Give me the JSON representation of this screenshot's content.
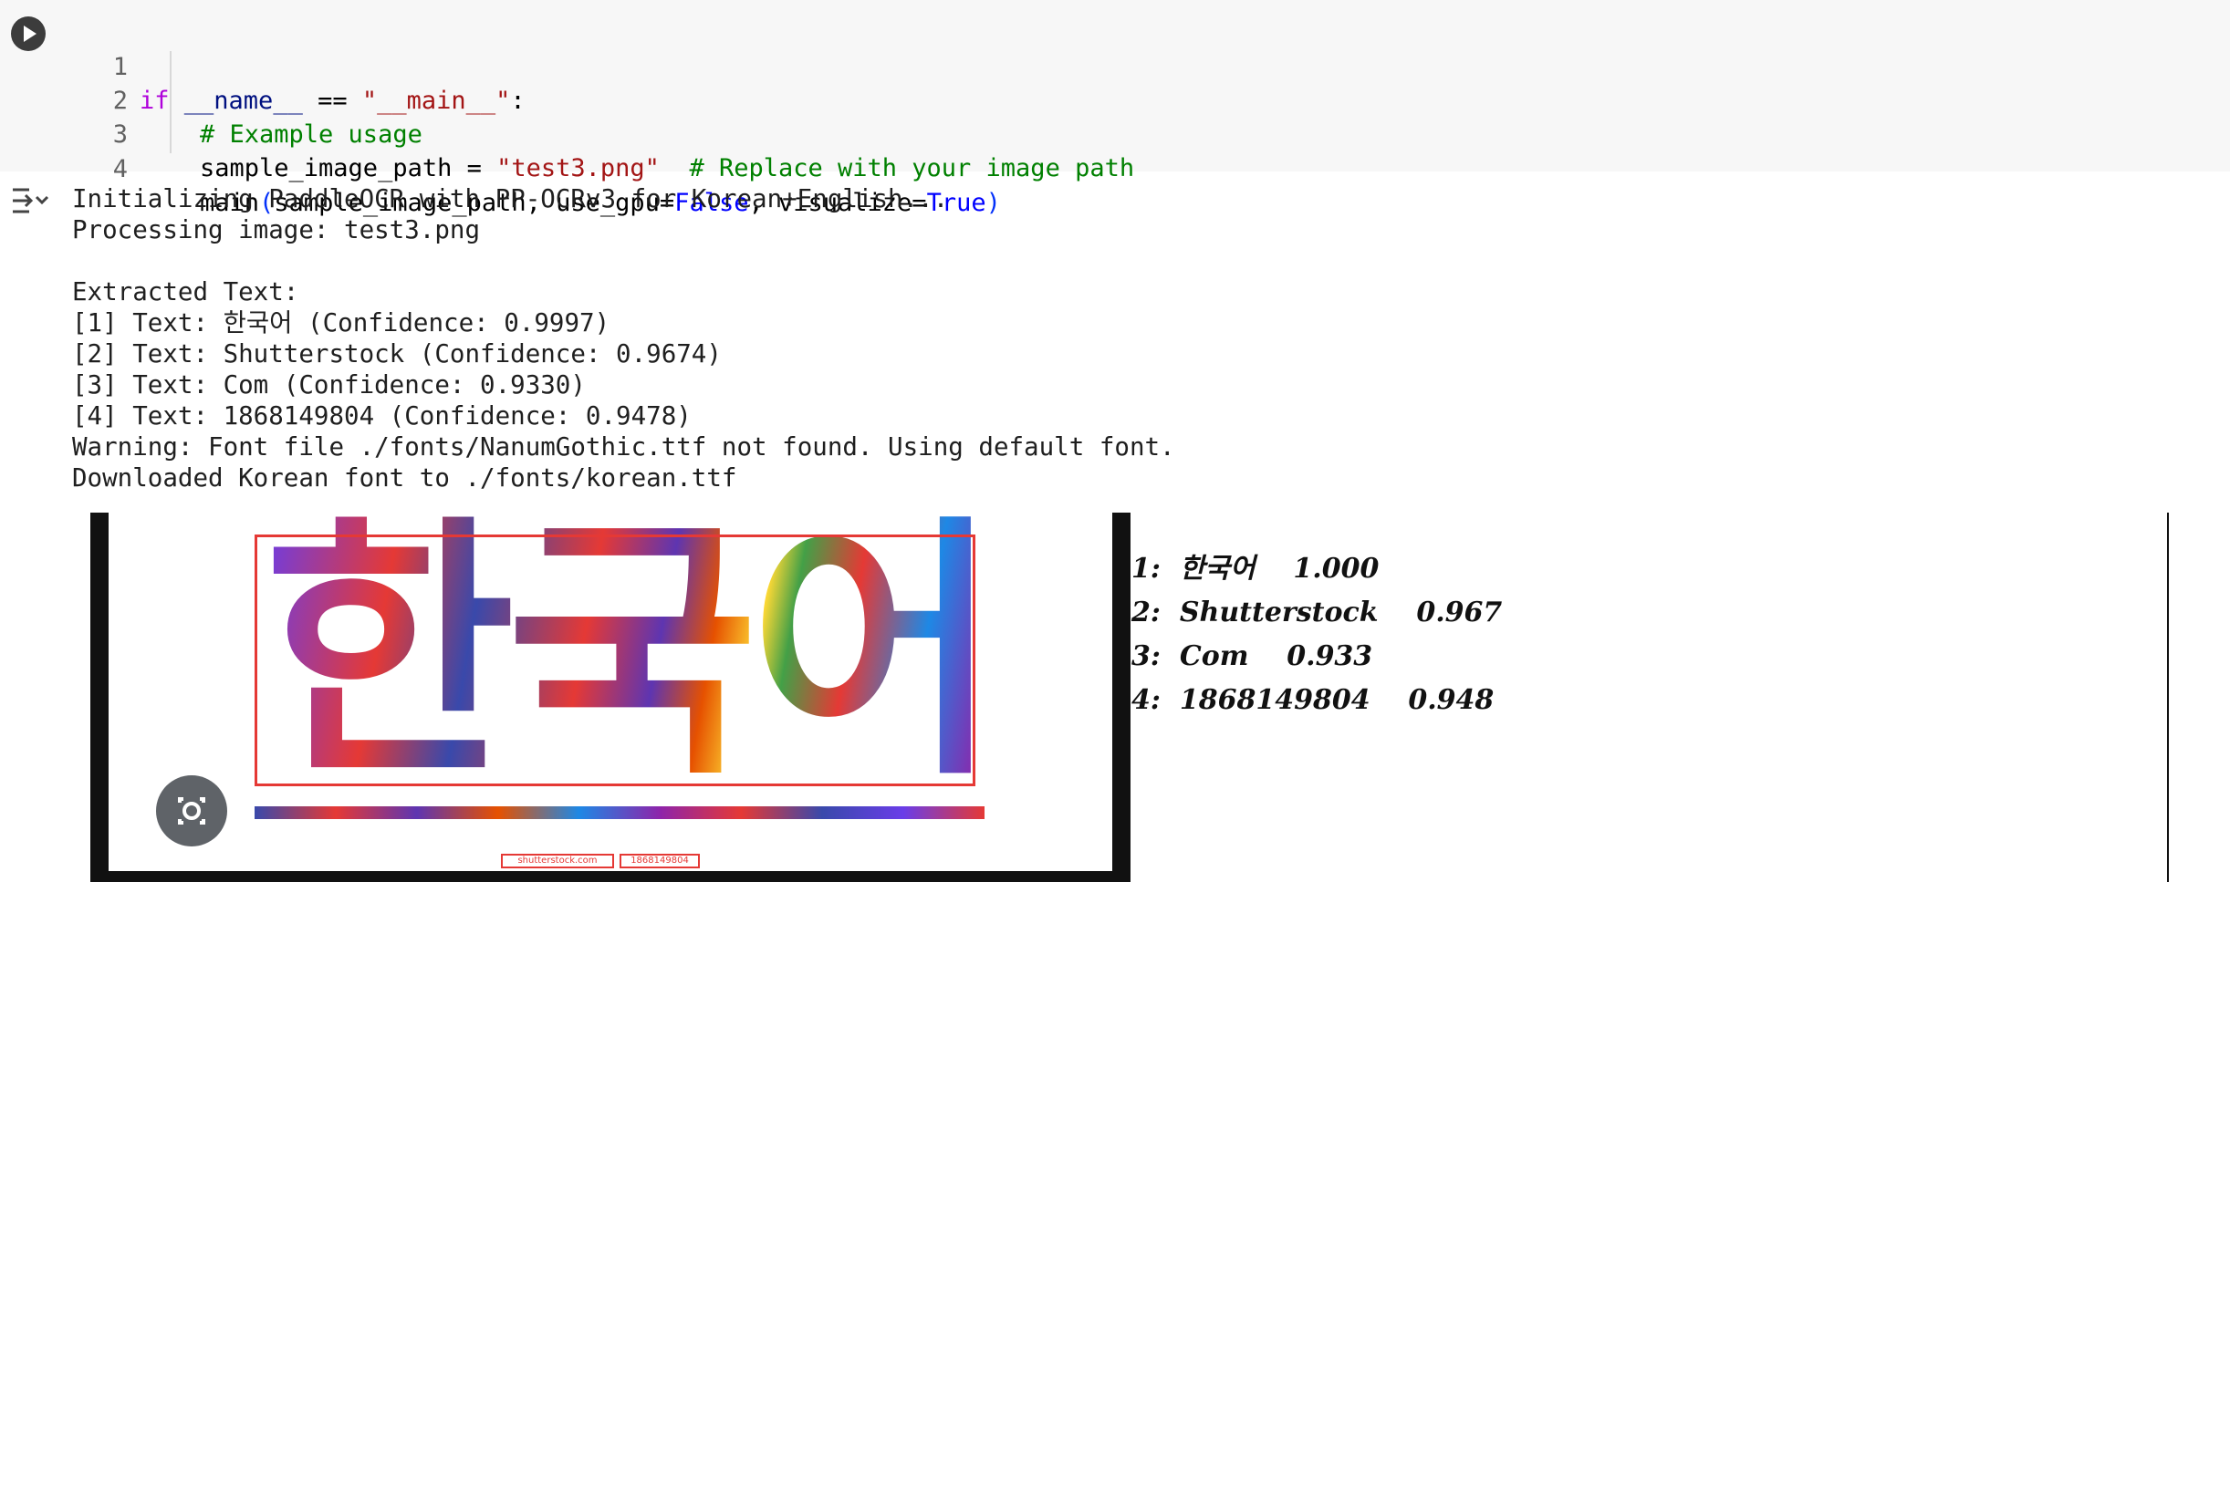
{
  "code_cell": {
    "line_numbers": [
      "1",
      "2",
      "3",
      "4"
    ],
    "line1": {
      "kw": "if",
      "space1": " ",
      "var": "__name__",
      "op": " == ",
      "str": "\"__main__\"",
      "colon": ":"
    },
    "line2": {
      "comment": "# Example usage"
    },
    "line3": {
      "lhs": "sample_image_path = ",
      "str": "\"test3.png\"",
      "gap": "  ",
      "comment": "# Replace with your image path"
    },
    "line4": {
      "fn": "main",
      "lparen": "(",
      "args1": "sample_image_path, use_gpu=",
      "false": "False",
      "args2": ", visualize=",
      "true": "True",
      "rparen": ")"
    }
  },
  "output": {
    "lines": [
      "Initializing PaddleOCR with PP-OCRv3 for Korean+English...",
      "Processing image: test3.png",
      "",
      "Extracted Text:",
      "[1] Text: 한국어 (Confidence: 0.9997)",
      "[2] Text: Shutterstock (Confidence: 0.9674)",
      "[3] Text: Com (Confidence: 0.9330)",
      "[4] Text: 1868149804 (Confidence: 0.9478)",
      "Warning: Font file ./fonts/NanumGothic.ttf not found. Using default font.",
      "Downloaded Korean font to ./fonts/korean.ttf"
    ]
  },
  "visualization": {
    "image_text": "한국어",
    "watermark": [
      "shutterstock.com",
      "1868149804"
    ],
    "results": [
      "1:  한국어    1.000",
      "2:  Shutterstock    0.967",
      "3:  Com    0.933",
      "4:  1868149804    0.948"
    ]
  },
  "icons": {
    "run": "play-circle-icon",
    "output_toggle": "output-collapse-icon",
    "lens": "google-lens-icon"
  },
  "colors": {
    "cell_bg": "#f7f7f7",
    "keyword": "#af00db",
    "string": "#a31515",
    "comment": "#008000",
    "boolean": "#0000ff",
    "box": "#e53935"
  }
}
